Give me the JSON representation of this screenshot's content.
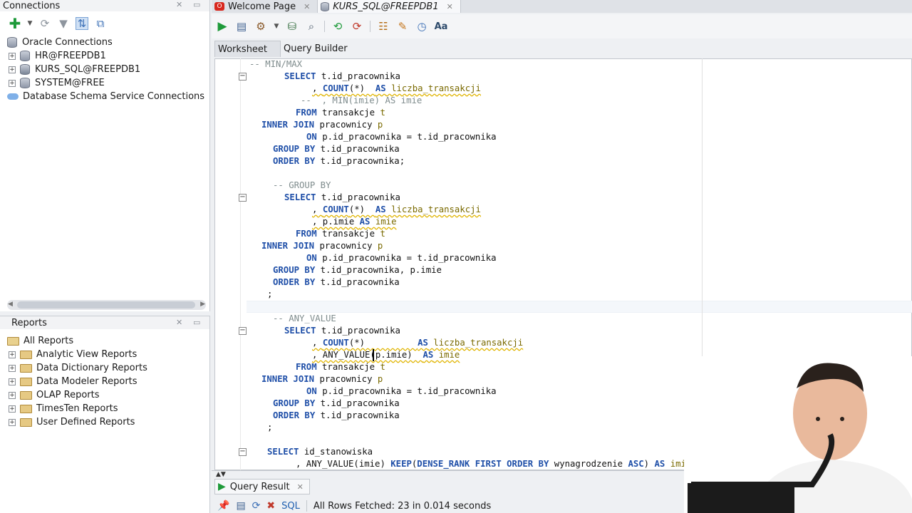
{
  "connections_panel": {
    "title": "Connections",
    "root": "Oracle Connections",
    "items": [
      {
        "label": "HR@FREEPDB1"
      },
      {
        "label": "KURS_SQL@FREEPDB1"
      },
      {
        "label": "SYSTEM@FREE"
      }
    ],
    "cloud_item": "Database Schema Service Connections"
  },
  "reports_panel": {
    "title": "Reports",
    "root": "All Reports",
    "items": [
      {
        "label": "Analytic View Reports"
      },
      {
        "label": "Data Dictionary Reports"
      },
      {
        "label": "Data Modeler Reports"
      },
      {
        "label": "OLAP Reports"
      },
      {
        "label": "TimesTen Reports"
      },
      {
        "label": "User Defined Reports"
      }
    ]
  },
  "editor": {
    "tabs": [
      {
        "label": "Welcome Page"
      },
      {
        "label": "KURS_SQL@FREEPDB1"
      }
    ],
    "subtabs": [
      {
        "label": "Worksheet"
      },
      {
        "label": "Query Builder"
      }
    ]
  },
  "code_lines": [
    {
      "c": "-- MIN/MAX"
    },
    {
      "k1": "SELECT",
      "t": " t.id_pracownika"
    },
    {
      "t": ", ",
      "k1": "COUNT",
      "t2": "(*)  ",
      "k2": "AS",
      "a": " liczba_transakcji"
    },
    {
      "c": "--  , MIN(imie) AS imie"
    },
    {
      "k1": "FROM",
      "t": " transakcje ",
      "a": "t"
    },
    {
      "k1": "INNER JOIN",
      "t": " pracownicy ",
      "a": "p"
    },
    {
      "k1": "ON",
      "t": " p.id_pracownika = t.id_pracownika"
    },
    {
      "k1": "GROUP BY",
      "t": " t.id_pracownika"
    },
    {
      "k1": "ORDER BY",
      "t": " t.id_pracownika;"
    },
    {
      "c": "-- GROUP BY"
    },
    {
      "k1": "SELECT",
      "t": " t.id_pracownika"
    },
    {
      "t": ", ",
      "k1": "COUNT",
      "t2": "(*)  ",
      "k2": "AS",
      "a": " liczba_transakcji"
    },
    {
      "t": ", p.imie ",
      "k1": "AS",
      "a": " imie"
    },
    {
      "k1": "FROM",
      "t": " transakcje ",
      "a": "t"
    },
    {
      "k1": "INNER JOIN",
      "t": " pracownicy ",
      "a": "p"
    },
    {
      "k1": "ON",
      "t": " p.id_pracownika = t.id_pracownika"
    },
    {
      "k1": "GROUP BY",
      "t": " t.id_pracownika, p.imie"
    },
    {
      "k1": "ORDER BY",
      "t": " t.id_pracownika"
    },
    {
      "t": ";"
    },
    {
      "c": "-- ANY_VALUE"
    },
    {
      "k1": "SELECT",
      "t": " t.id_pracownika"
    },
    {
      "t": ", ",
      "k1": "COUNT",
      "t2": "(*)          ",
      "k2": "AS",
      "a": " liczba_transakcji"
    },
    {
      "t": ", ANY_VALUE(p.imie)  ",
      "k1": "AS",
      "a": " imie"
    },
    {
      "k1": "FROM",
      "t": " transakcje ",
      "a": "t"
    },
    {
      "k1": "INNER JOIN",
      "t": " pracownicy ",
      "a": "p"
    },
    {
      "k1": "ON",
      "t": " p.id_pracownika = t.id_pracownika"
    },
    {
      "k1": "GROUP BY",
      "t": " t.id_pracownika"
    },
    {
      "k1": "ORDER BY",
      "t": " t.id_pracownika"
    },
    {
      "t": ";"
    },
    {
      "k1": "SELECT",
      "t": " id_stanowiska"
    },
    {
      "t": ", ANY_VALUE(imie) ",
      "k1": "KEEP",
      "t2": "(",
      "k2": "DENSE_RANK FIRST ORDER BY",
      "t3": " wynagrodzenie ",
      "k3": "ASC",
      "t4": ") ",
      "k4": "AS",
      "a": " imie"
    }
  ],
  "result_panel": {
    "tab_label": "Query Result",
    "sql_label": "SQL",
    "status": "All Rows Fetched: 23 in 0.014 seconds"
  },
  "colors": {
    "keyword": "#1f4fa8",
    "comment": "#7f8c8d",
    "alias": "#7a6a00",
    "run_green": "#1e9a3a",
    "oracle_red": "#d8281e"
  }
}
